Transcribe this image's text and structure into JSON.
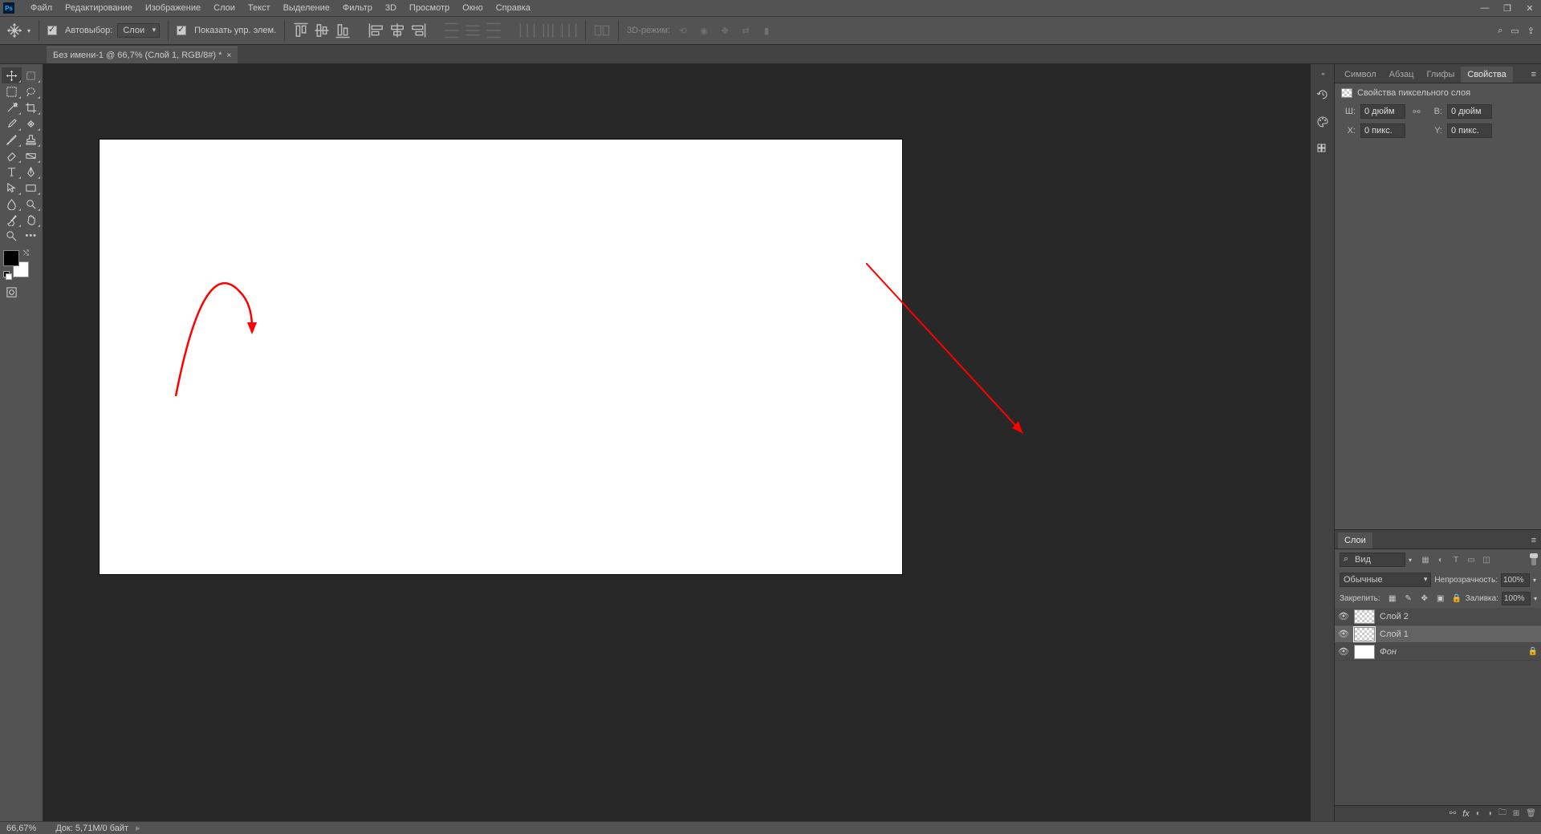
{
  "menu": {
    "items": [
      "Файл",
      "Редактирование",
      "Изображение",
      "Слои",
      "Текст",
      "Выделение",
      "Фильтр",
      "3D",
      "Просмотр",
      "Окно",
      "Справка"
    ]
  },
  "options": {
    "auto_select": "Автовыбор:",
    "layer_dropdown": "Слои",
    "show_transform": "Показать упр. элем.",
    "mode3d": "3D-режим:"
  },
  "tab": {
    "title": "Без имени-1 @ 66,7% (Слой 1, RGB/8#) *"
  },
  "panels": {
    "symbol": "Символ",
    "paragraph": "Абзац",
    "glyphs": "Глифы",
    "properties": "Свойства",
    "properties_section": "Свойства пиксельного слоя",
    "W": "Ш:",
    "H": "В:",
    "X": "X:",
    "Y": "Y:",
    "W_val": "0 дюйм",
    "H_val": "0 дюйм",
    "X_val": "0 пикс.",
    "Y_val": "0 пикс."
  },
  "layers": {
    "title": "Слои",
    "filter_kind": "Вид",
    "blend_mode": "Обычные",
    "opacity_label": "Непрозрачность:",
    "opacity_val": "100%",
    "lock_label": "Закрепить:",
    "fill_label": "Заливка:",
    "fill_val": "100%",
    "items": [
      {
        "name": "Слой 2",
        "visible": true,
        "bg": false
      },
      {
        "name": "Слой 1",
        "visible": true,
        "bg": false
      },
      {
        "name": "Фон",
        "visible": true,
        "bg": true,
        "locked": true
      }
    ]
  },
  "status": {
    "zoom": "66,67%",
    "doc": "Док: 5,71M/0 байт"
  }
}
